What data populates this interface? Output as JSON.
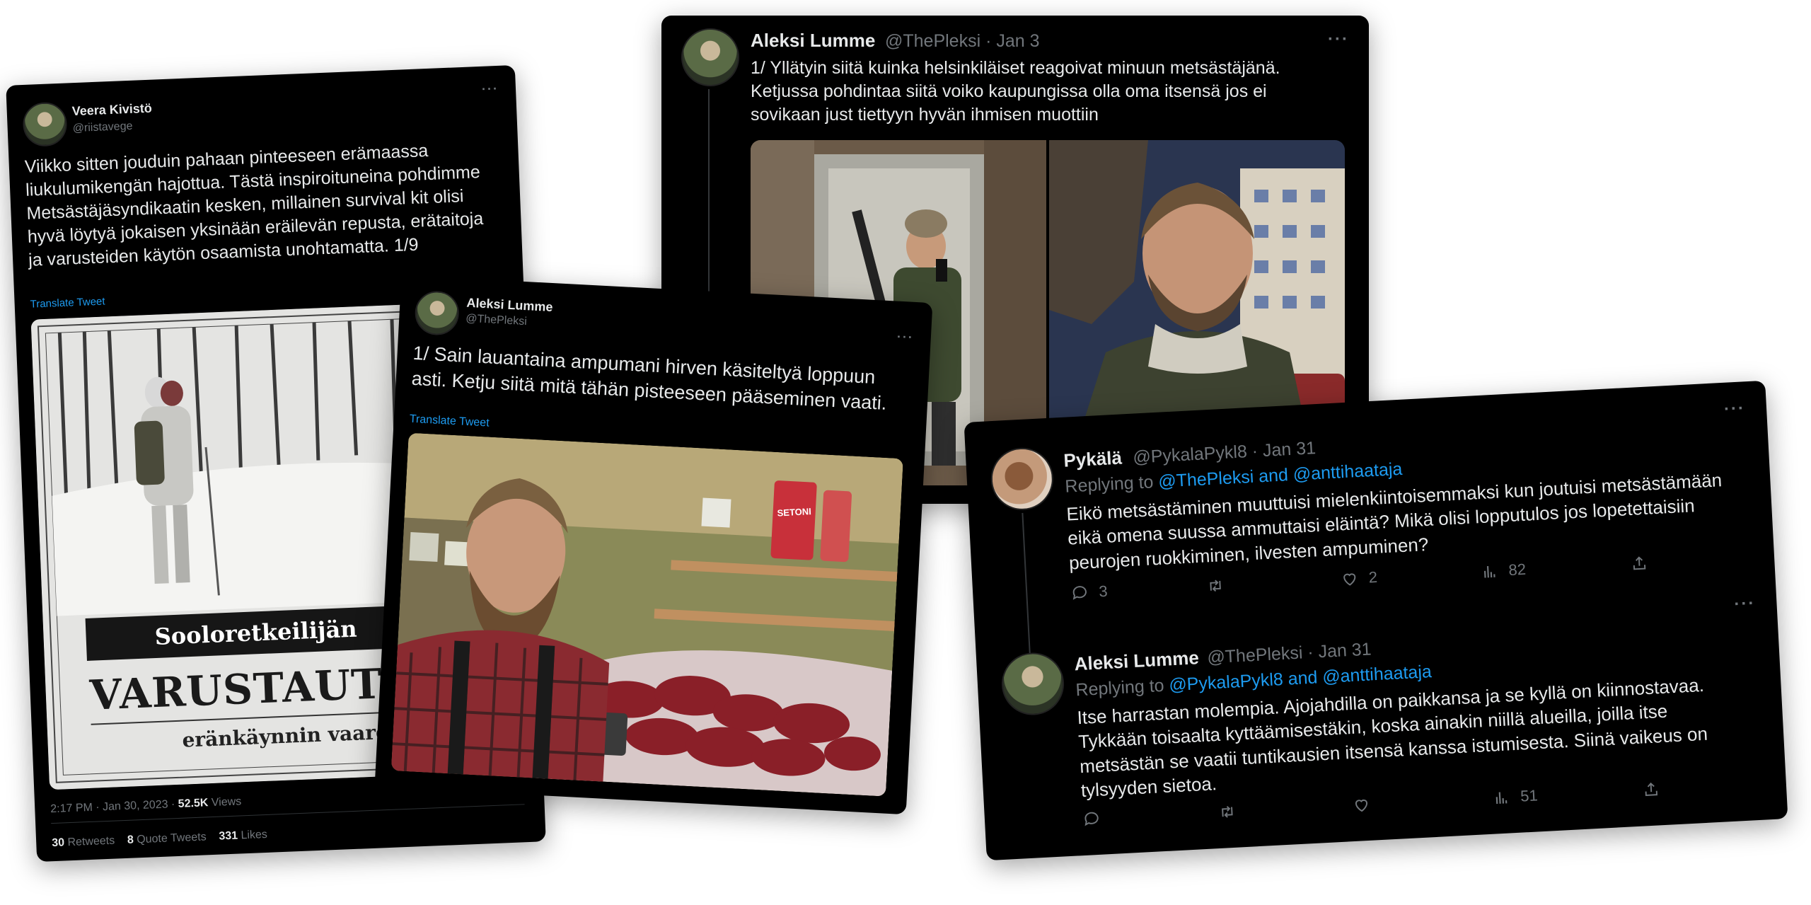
{
  "card1": {
    "author_name": "Veera Kivistö",
    "author_handle": "@riistavege",
    "more": "···",
    "text": "Viikko sitten jouduin pahaan pinteeseen erämaassa liukulumikengän hajottua. Tästä inspiroituneina pohdimme Metsästäjäsyndikaatin kesken, millainen survival kit olisi hyvä löytyä jokaisen yksinään eräilevän repusta, erätaitoja ja varusteiden käytön osaamista unohtamatta. 1/9",
    "translate": "Translate Tweet",
    "image": {
      "subtitle": "Sooloretkeilijän",
      "title": "VARUSTAUTUMI",
      "caption": "eränkäynnin vaaroih"
    },
    "timestamp": "2:17 PM · Jan 30, 2023 · ",
    "views_count": "52.5K",
    "views_label": " Views",
    "retweets_count": "30",
    "retweets_label": "Retweets",
    "quotes_count": "8",
    "quotes_label": "Quote Tweets",
    "likes_count": "331",
    "likes_label": "Likes"
  },
  "card2": {
    "author_name": "Aleksi Lumme",
    "author_handle": "@ThePleksi",
    "more": "···",
    "text": "1/ Sain lauantaina ampumani hirven käsiteltyä loppuun asti. Ketju siitä mitä tähän pisteeseen pääseminen vaati.",
    "translate": "Translate Tweet",
    "image_label": "SETONI"
  },
  "card3": {
    "author_name": "Aleksi Lumme",
    "author_handle": "@ThePleksi · Jan 3",
    "more": "···",
    "text": "1/ Yllätyin siitä kuinka helsinkiläiset reagoivat minuun metsästäjänä. Ketjussa pohdintaa siitä voiko kaupungissa olla oma itsensä jos ei sovikaan just tiettyyn hyvän ihmisen muottiin"
  },
  "card4": {
    "reply1": {
      "author_name": "Pykälä",
      "author_handle": "@PykalaPykl8 · Jan 31",
      "replying_to": "Replying to ",
      "mentions": "@ThePleksi and @anttihaataja",
      "text": "Eikö metsästäminen muuttuisi mielenkiintoisemmaksi kun joutuisi metsästämään eikä omena suussa ammuttaisi eläintä?  Mikä olisi lopputulos jos lopetettaisiin peurojen ruokkiminen, ilvesten ampuminen?",
      "replies": "3",
      "retweets": "",
      "likes": "2",
      "views": "82"
    },
    "reply2": {
      "author_name": "Aleksi Lumme",
      "author_handle": "@ThePleksi · Jan 31",
      "replying_to": "Replying to ",
      "mentions": "@PykalaPykl8 and @anttihaataja",
      "text": "Itse harrastan molempia. Ajojahdilla on paikkansa ja se kyllä on kiinnostavaa. Tykkään toisaalta kyttäämisestäkin, koska ainakin niillä alueilla, joilla itse metsästän se vaatii tuntikausien itsensä kanssa istumisesta. Siinä vaikeus on tylsyyden sietoa.",
      "replies": "",
      "retweets": "",
      "likes": "",
      "views": "51"
    },
    "more": "···"
  }
}
